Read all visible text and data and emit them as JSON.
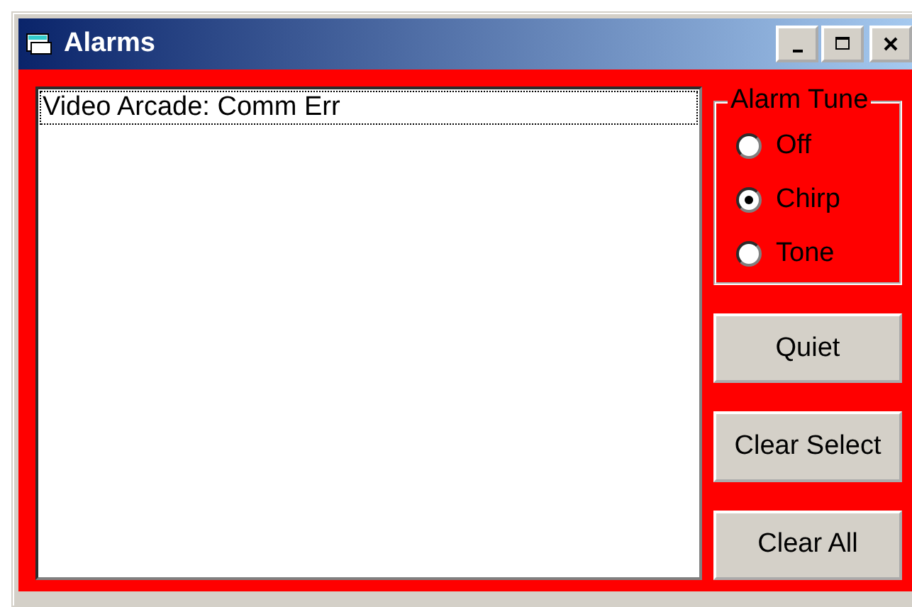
{
  "window": {
    "title": "Alarms"
  },
  "alarms": [
    {
      "text": "Video Arcade: Comm Err",
      "focused": true
    }
  ],
  "alarm_tune": {
    "label": "Alarm Tune",
    "options": [
      {
        "label": "Off",
        "selected": false
      },
      {
        "label": "Chirp",
        "selected": true
      },
      {
        "label": "Tone",
        "selected": false
      }
    ]
  },
  "buttons": [
    "Quiet",
    "Clear Select",
    "Clear All"
  ]
}
